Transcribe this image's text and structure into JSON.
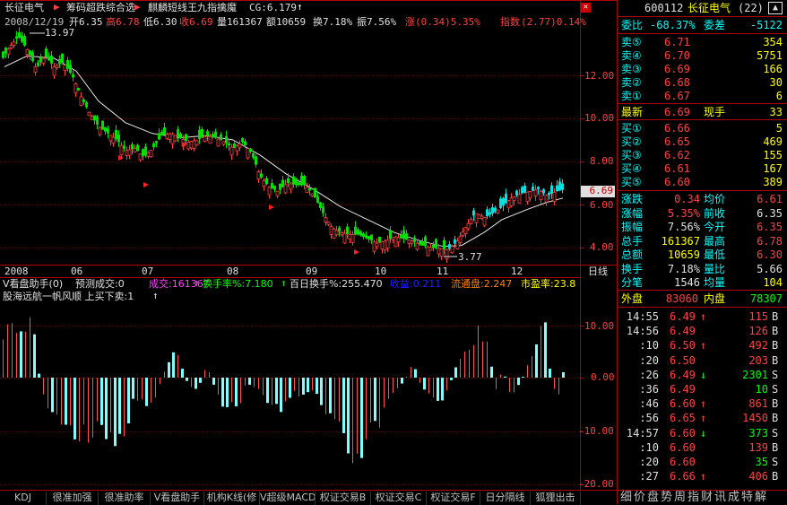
{
  "header": {
    "stock_name": "长征电气",
    "indicator_set": "筹码超跌综合选",
    "indicator_name": "麒麟短线王九指擒魔",
    "cg": "CG:6.179",
    "ohlc_line": {
      "date": "2008/12/19",
      "open_label": "开",
      "open": "6.35",
      "high_label": "高",
      "high": "6.78",
      "low_label": "低",
      "low": "6.30",
      "close_label": "收",
      "close": "6.69",
      "volume_label": "量",
      "volume": "161367",
      "amount_label": "额",
      "amount": "10659",
      "turnover_label": "换",
      "turnover": "7.18%",
      "amplitude_label": "振",
      "amplitude": "7.56%",
      "rise_label": "涨",
      "rise": "(0.34)5.35%",
      "index_label": "指数",
      "index": "(2.77)0.14%"
    },
    "max_price_label": "13.97",
    "min_price_label": "3.77",
    "current_price_tag": "6.69"
  },
  "main_chart": {
    "y_ticks": [
      "12.00",
      "10.00",
      "8.00",
      "6.00",
      "4.00"
    ],
    "x_labels": [
      "2008",
      "06",
      "07",
      "08",
      "09",
      "10",
      "11",
      "12"
    ],
    "period_label": "日线"
  },
  "sub_chart": {
    "title_line": {
      "name": "V看盘助手(0)",
      "forecast": "预测成交:0",
      "volume": "成交:161367",
      "turnover": "换手率%:7.180",
      "turnover100": "百日换手%:255.470",
      "profit": "收益:0.211",
      "float_shares": "流通盘:2.247",
      "pe": "市盈率:23.8"
    },
    "second_line": "股海远航一帆风顺 上买下卖:1",
    "y_ticks": [
      "10.00",
      "0.00",
      "-10.00",
      "-20.00"
    ]
  },
  "chart_data": {
    "type": "candlestick",
    "price_range": [
      3.77,
      13.97
    ],
    "bar_count": 225,
    "oscillator_range": [
      -20,
      12
    ]
  },
  "right_panel": {
    "code": "600112",
    "name": "长征电气",
    "badge": "(22)",
    "weibi_label": "委比",
    "weibi": "-68.37%",
    "weicha_label": "委差",
    "weicha": "-5122",
    "sells": [
      {
        "label": "卖⑤",
        "price": "6.71",
        "vol": "354"
      },
      {
        "label": "卖④",
        "price": "6.70",
        "vol": "5751"
      },
      {
        "label": "卖③",
        "price": "6.69",
        "vol": "166"
      },
      {
        "label": "卖②",
        "price": "6.68",
        "vol": "30"
      },
      {
        "label": "卖①",
        "price": "6.67",
        "vol": "6"
      }
    ],
    "latest_label": "最新",
    "latest": "6.69",
    "current_hand_label": "现手",
    "current_hand": "33",
    "buys": [
      {
        "label": "买①",
        "price": "6.66",
        "vol": "5"
      },
      {
        "label": "买②",
        "price": "6.65",
        "vol": "469"
      },
      {
        "label": "买③",
        "price": "6.62",
        "vol": "155"
      },
      {
        "label": "买④",
        "price": "6.61",
        "vol": "167"
      },
      {
        "label": "买⑤",
        "price": "6.60",
        "vol": "389"
      }
    ],
    "stats": [
      {
        "l1": "涨跌",
        "v1": "0.34",
        "l2": "均价",
        "v2": "6.61"
      },
      {
        "l1": "涨幅",
        "v1": "5.35%",
        "l2": "前收",
        "v2": "6.35"
      },
      {
        "l1": "振幅",
        "v1": "7.56%",
        "l2": "今开",
        "v2": "6.35"
      },
      {
        "l1": "总手",
        "v1": "161367",
        "l2": "最高",
        "v2": "6.78"
      },
      {
        "l1": "总额",
        "v1": "10659",
        "l2": "最低",
        "v2": "6.30"
      },
      {
        "l1": "换手",
        "v1": "7.18%",
        "l2": "量比",
        "v2": "5.66"
      },
      {
        "l1": "分笔",
        "v1": "1546",
        "l2": "均量",
        "v2": "104"
      }
    ],
    "outer_label": "外盘",
    "outer": "83060",
    "inner_label": "内盘",
    "inner": "78307",
    "ticks": [
      {
        "time": "14:55",
        "price": "6.49",
        "arrow": "↑",
        "vol": "115",
        "bs": "B"
      },
      {
        "time": "14:56",
        "price": "6.49",
        "arrow": "",
        "vol": "126",
        "bs": "B"
      },
      {
        "time": ":10",
        "price": "6.50",
        "arrow": "↑",
        "vol": "492",
        "bs": "B"
      },
      {
        "time": ":20",
        "price": "6.50",
        "arrow": "",
        "vol": "203",
        "bs": "B"
      },
      {
        "time": ":26",
        "price": "6.49",
        "arrow": "↓",
        "vol": "2301",
        "bs": "S"
      },
      {
        "time": ":36",
        "price": "6.49",
        "arrow": "",
        "vol": "10",
        "bs": "S"
      },
      {
        "time": ":46",
        "price": "6.60",
        "arrow": "↑",
        "vol": "861",
        "bs": "B"
      },
      {
        "time": ":56",
        "price": "6.65",
        "arrow": "↑",
        "vol": "1450",
        "bs": "B"
      },
      {
        "time": "14:57",
        "price": "6.60",
        "arrow": "↓",
        "vol": "373",
        "bs": "S"
      },
      {
        "time": ":10",
        "price": "6.60",
        "arrow": "",
        "vol": "139",
        "bs": "B"
      },
      {
        "time": ":20",
        "price": "6.60",
        "arrow": "",
        "vol": "35",
        "bs": "S"
      },
      {
        "time": ":27",
        "price": "6.66",
        "arrow": "↑",
        "vol": "406",
        "bs": "B"
      }
    ]
  },
  "bottom_tabs": [
    "KDJ",
    "很准加强",
    "很准助率",
    "V看盘助手",
    "机构K线(修",
    "V超级MACD",
    "权证交易B",
    "权证交易C",
    "权证交易F",
    "日分隔线",
    "狐狸出击"
  ],
  "side_tabs": "细价盘势周指财讯成特解"
}
